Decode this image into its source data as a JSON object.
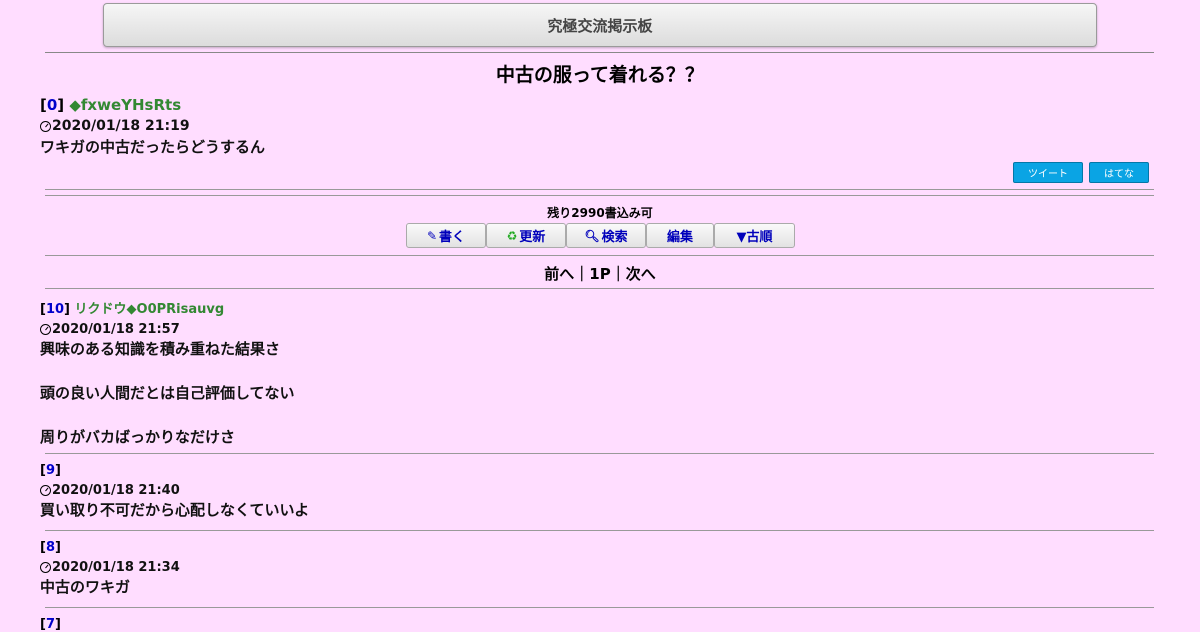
{
  "board_title": "究極交流掲示板",
  "thread_title": "中古の服って着れる？？",
  "op": {
    "num": "0",
    "author": "◆fxweYHsRts",
    "date": "2020/01/18 21:19",
    "body": "ワキガの中古だったらどうするん"
  },
  "share": {
    "tweet": "ツイート",
    "hatena": "はてな"
  },
  "remaining": "残り2990書込み可",
  "actions": {
    "write": "書く",
    "write_icon": "✎",
    "refresh": "更新",
    "refresh_icon": "♻",
    "search": "検索",
    "search_icon": "🔍︎",
    "edit": "編集",
    "order": "▼古順"
  },
  "pager": {
    "prev": "前へ",
    "sep": "｜",
    "page": "1P",
    "next": "次へ"
  },
  "posts": [
    {
      "num": "10",
      "author": "リクドウ◆O0PRisauvg",
      "date": "2020/01/18 21:57",
      "lines": [
        "興味のある知識を積み重ねた結果さ",
        "",
        "頭の良い人間だとは自己評価してない",
        "",
        "周りがバカばっかりなだけさ"
      ]
    },
    {
      "num": "9",
      "author": "",
      "date": "2020/01/18 21:40",
      "lines": [
        "買い取り不可だから心配しなくていいよ"
      ]
    },
    {
      "num": "8",
      "author": "",
      "date": "2020/01/18 21:34",
      "lines": [
        "中古のワキガ"
      ]
    },
    {
      "num": "7",
      "author": "",
      "date": "",
      "lines": []
    }
  ]
}
